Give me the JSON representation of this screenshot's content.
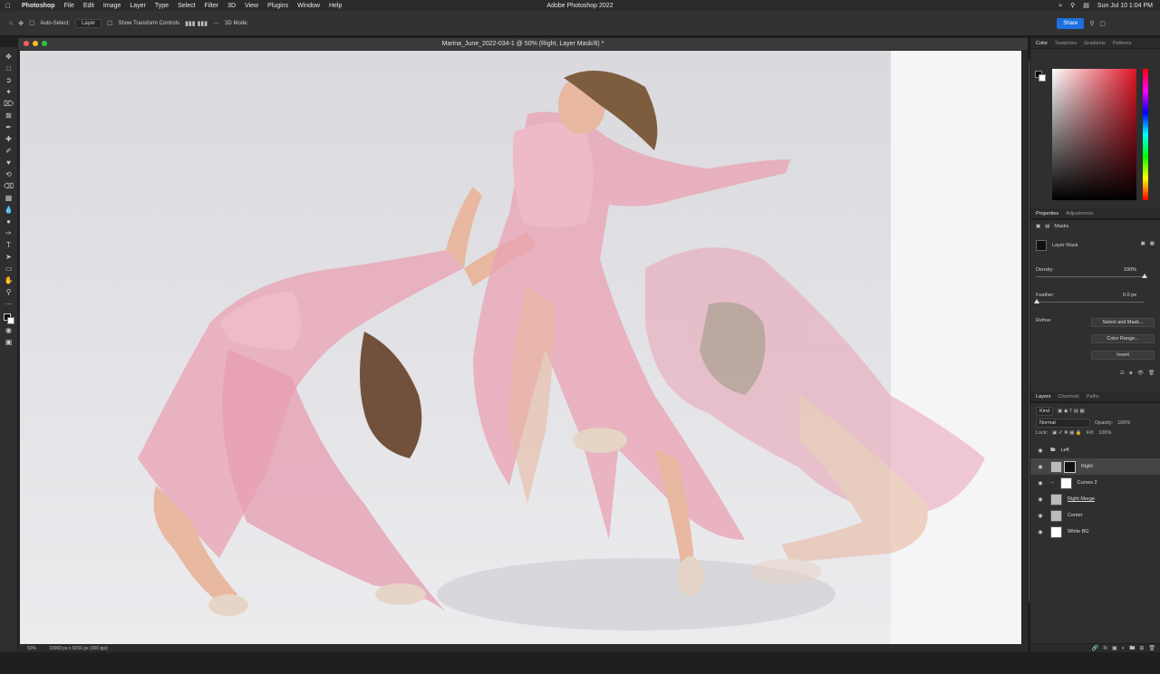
{
  "menubar": {
    "app_name": "Photoshop",
    "menus": [
      "File",
      "Edit",
      "Image",
      "Layer",
      "Type",
      "Select",
      "Filter",
      "3D",
      "View",
      "Plugins",
      "Window",
      "Help"
    ],
    "center_title": "Adobe Photoshop 2022",
    "clock": "Sun Jul 10  1:04 PM"
  },
  "options": {
    "auto_select_label": "Auto-Select:",
    "auto_select_value": "Layer",
    "transform_label": "Show Transform Controls",
    "mode_3d": "3D Mode:",
    "share_label": "Share"
  },
  "document": {
    "title": "Marina_June_2022-034-1 @ 50% (Right, Layer Mask/8) *",
    "zoom": "50%",
    "dimensions": "10000 px x 8256 px (300 ppi)"
  },
  "color_panel": {
    "tabs": [
      "Color",
      "Swatches",
      "Gradients",
      "Patterns"
    ]
  },
  "properties": {
    "tabs": [
      "Properties",
      "Adjustments"
    ],
    "section": "Masks",
    "mask_type": "Layer Mask",
    "density_label": "Density:",
    "density_value": "100%",
    "density_fraction": 1.0,
    "feather_label": "Feather:",
    "feather_value": "0.0 px",
    "refine_label": "Refine:",
    "buttons": [
      "Select and Mask...",
      "Color Range...",
      "Invert"
    ]
  },
  "layers": {
    "tabs": [
      "Layers",
      "Channels",
      "Paths"
    ],
    "kind_label": "Kind",
    "blend_mode": "Normal",
    "opacity_label": "Opacity:",
    "opacity_value": "100%",
    "lock_label": "Lock:",
    "fill_label": "Fill:",
    "fill_value": "100%",
    "items": [
      {
        "name": "Left",
        "type": "group",
        "selected": false
      },
      {
        "name": "Right",
        "type": "pixel-mask",
        "selected": true
      },
      {
        "name": "Curves 2",
        "type": "adjustment",
        "selected": false
      },
      {
        "name": "Right Merge",
        "type": "pixel",
        "selected": false
      },
      {
        "name": "Center",
        "type": "pixel",
        "selected": false
      },
      {
        "name": "White BG",
        "type": "fill",
        "selected": false
      }
    ]
  }
}
